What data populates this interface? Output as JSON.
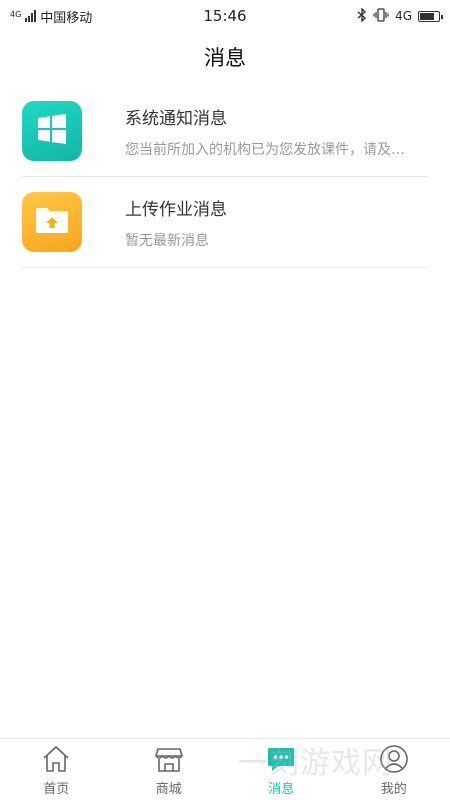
{
  "status_bar": {
    "network_type": "4G",
    "carrier": "中国移动",
    "time": "15:46",
    "right_network": "4G"
  },
  "header": {
    "title": "消息"
  },
  "messages": [
    {
      "title": "系统通知消息",
      "subtitle": "您当前所加入的机构已为您发放课件，请及…",
      "icon": "windows-icon",
      "color": "#17c9b7"
    },
    {
      "title": "上传作业消息",
      "subtitle": "暂无最新消息",
      "icon": "folder-upload-icon",
      "color": "#fbb52c"
    }
  ],
  "bottom_nav": {
    "items": [
      {
        "label": "首页",
        "icon": "home-icon",
        "active": false
      },
      {
        "label": "商城",
        "icon": "store-icon",
        "active": false
      },
      {
        "label": "消息",
        "icon": "chat-icon",
        "active": true
      },
      {
        "label": "我的",
        "icon": "profile-icon",
        "active": false
      }
    ]
  },
  "watermark": {
    "text": "一刻游戏网"
  },
  "colors": {
    "accent": "#1cbfae"
  }
}
